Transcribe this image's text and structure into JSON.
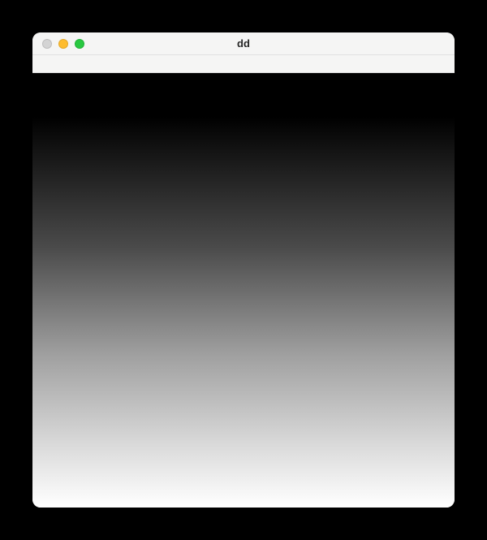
{
  "window": {
    "title": "dd"
  }
}
